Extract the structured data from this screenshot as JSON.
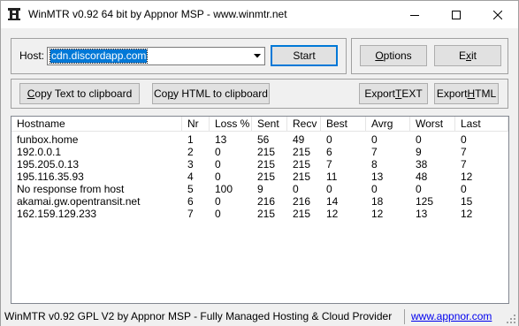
{
  "window": {
    "title": "WinMTR v0.92 64 bit by Appnor MSP - www.winmtr.net",
    "icon": "winmtr-app-icon"
  },
  "host": {
    "label": "Host:",
    "value": "cdn.discordapp.com"
  },
  "buttons": {
    "start": "Start",
    "options_pre": "",
    "options_acc": "O",
    "options_post": "ptions",
    "exit_pre": "E",
    "exit_acc": "x",
    "exit_post": "it",
    "copy_text_pre": "",
    "copy_text_acc": "C",
    "copy_text_post": "opy Text to clipboard",
    "copy_html_pre": "Co",
    "copy_html_acc": "p",
    "copy_html_post": "y HTML to clipboard",
    "export_text_pre": "Export ",
    "export_text_acc": "T",
    "export_text_post": "EXT",
    "export_html_pre": "Export ",
    "export_html_acc": "H",
    "export_html_post": "TML"
  },
  "table": {
    "columns": [
      "Hostname",
      "Nr",
      "Loss %",
      "Sent",
      "Recv",
      "Best",
      "Avrg",
      "Worst",
      "Last"
    ],
    "rows": [
      [
        "funbox.home",
        "1",
        "13",
        "56",
        "49",
        "0",
        "0",
        "0",
        "0"
      ],
      [
        "192.0.0.1",
        "2",
        "0",
        "215",
        "215",
        "6",
        "7",
        "9",
        "7"
      ],
      [
        "195.205.0.13",
        "3",
        "0",
        "215",
        "215",
        "7",
        "8",
        "38",
        "7"
      ],
      [
        "195.116.35.93",
        "4",
        "0",
        "215",
        "215",
        "11",
        "13",
        "48",
        "12"
      ],
      [
        "No response from host",
        "5",
        "100",
        "9",
        "0",
        "0",
        "0",
        "0",
        "0"
      ],
      [
        "akamai.gw.opentransit.net",
        "6",
        "0",
        "216",
        "216",
        "14",
        "18",
        "125",
        "15"
      ],
      [
        "162.159.129.233",
        "7",
        "0",
        "215",
        "215",
        "12",
        "12",
        "13",
        "12"
      ]
    ]
  },
  "status": {
    "text": "WinMTR v0.92 GPL V2 by Appnor MSP - Fully Managed Hosting & Cloud Provider",
    "link": "www.appnor.com"
  },
  "colors": {
    "selection": "#0078d7",
    "link": "#0000ee",
    "face": "#f0f0f0"
  }
}
